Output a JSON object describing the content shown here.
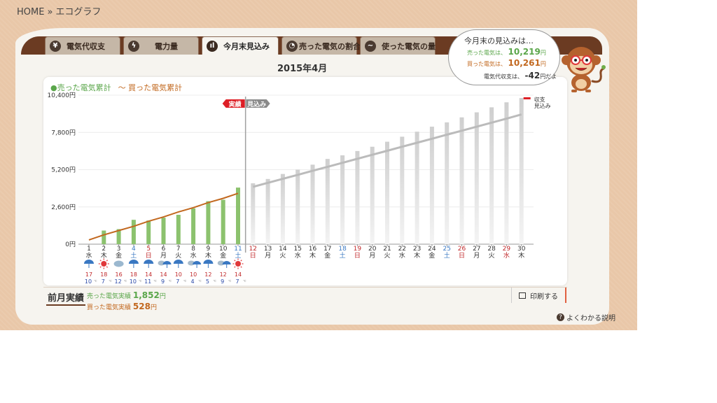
{
  "breadcrumb": {
    "home": "HOME",
    "separator": "»",
    "current": "エコグラフ"
  },
  "tabs": [
    {
      "label": "電気代収支",
      "icon": "yen-icon",
      "glyph": "¥"
    },
    {
      "label": "電力量",
      "icon": "lightning-icon",
      "glyph": "ϟ"
    },
    {
      "label": "今月末見込み",
      "icon": "bar-chart-icon",
      "glyph": "ıl"
    },
    {
      "label": "売った電気の割合",
      "icon": "pie-chart-icon",
      "glyph": "◔"
    },
    {
      "label": "使った電気の量",
      "icon": "wave-icon",
      "glyph": "∼"
    }
  ],
  "active_tab": 2,
  "month_title": "2015年4月",
  "legend": {
    "sold": "●売った電気累計",
    "bought": "〜 買った電気累計"
  },
  "markers": {
    "actual": "実績",
    "forecast": "見込み",
    "end_label": [
      "収支",
      "見込み"
    ]
  },
  "chart_data": {
    "type": "bar",
    "y_ticks": [
      "0円",
      "2,600円",
      "5,200円",
      "7,800円",
      "10,400円"
    ],
    "ylim": [
      0,
      10400
    ],
    "days": [
      1,
      2,
      3,
      4,
      5,
      6,
      7,
      8,
      9,
      10,
      11,
      12,
      13,
      14,
      15,
      16,
      17,
      18,
      19,
      20,
      21,
      22,
      23,
      24,
      25,
      26,
      27,
      28,
      29,
      30
    ],
    "weekdays": [
      "水",
      "木",
      "金",
      "土",
      "日",
      "月",
      "火",
      "水",
      "木",
      "金",
      "土",
      "日",
      "月",
      "火",
      "水",
      "木",
      "金",
      "土",
      "日",
      "月",
      "火",
      "水",
      "木",
      "金",
      "土",
      "日",
      "月",
      "火",
      "水",
      "木"
    ],
    "day_colors": [
      "#333",
      "#333",
      "#333",
      "#3a78c2",
      "#c0282a",
      "#333",
      "#333",
      "#333",
      "#333",
      "#333",
      "#3a78c2",
      "#c0282a",
      "#333",
      "#333",
      "#333",
      "#333",
      "#333",
      "#3a78c2",
      "#c0282a",
      "#333",
      "#333",
      "#333",
      "#333",
      "#333",
      "#3a78c2",
      "#c0282a",
      "#333",
      "#333",
      "#c0282a",
      "#333"
    ],
    "actual_days": 11,
    "sold_cumulative": [
      0,
      950,
      1050,
      1700,
      1650,
      1850,
      2050,
      2500,
      3000,
      3100,
      3950,
      4250,
      4550,
      4900,
      5200,
      5550,
      5950,
      6200,
      6500,
      6800,
      7150,
      7500,
      7850,
      8200,
      8500,
      8850,
      9200,
      9550,
      9900,
      10200
    ],
    "bought_cumulative": [
      300,
      650,
      950,
      1250,
      1600,
      1900,
      2250,
      2550,
      2900,
      3200,
      3550,
      4000,
      4280,
      4560,
      4840,
      5120,
      5400,
      5680,
      5960,
      6240,
      6520,
      6800,
      7080,
      7360,
      7640,
      7920,
      8200,
      8480,
      8760,
      9050
    ],
    "weather": [
      {
        "icon": "rain-icon",
        "high": "17",
        "low": "10"
      },
      {
        "icon": "sun-icon",
        "high": "18",
        "low": "7"
      },
      {
        "icon": "cloud-icon",
        "high": "16",
        "low": "12"
      },
      {
        "icon": "rain-icon",
        "high": "18",
        "low": "10"
      },
      {
        "icon": "rain-icon",
        "high": "14",
        "low": "11"
      },
      {
        "icon": "cloud-rain-icon",
        "high": "14",
        "low": "9"
      },
      {
        "icon": "rain-icon",
        "high": "10",
        "low": "7"
      },
      {
        "icon": "cloud-rain-icon",
        "high": "10",
        "low": "4"
      },
      {
        "icon": "rain-icon",
        "high": "12",
        "low": "5"
      },
      {
        "icon": "cloud-rain-icon",
        "high": "12",
        "low": "9"
      },
      {
        "icon": "sun-icon",
        "high": "14",
        "low": "7"
      }
    ],
    "temp_unit": "℃",
    "colors": {
      "sold": "#8cc26e",
      "forecast": "#d3d3d3",
      "bought": "#c2681f",
      "high": "#c0282a",
      "low": "#2a48a8"
    }
  },
  "forecast": {
    "title": "今月末の見込みは…",
    "sold_label": "売った電気は、",
    "sold_value": "10,219",
    "sold_unit": "円",
    "bought_label": "買った電気は、",
    "bought_value": "10,261",
    "bought_unit": "円",
    "balance_label": "電気代収支は、",
    "balance_value": "-42",
    "balance_unit": "円だよ"
  },
  "previous_month": {
    "title": "前月実績",
    "sold_label": "売った電気実績",
    "sold_value": "1,852",
    "sold_unit": "円",
    "bought_label": "買った電気実績",
    "bought_value": "528",
    "bought_unit": "円"
  },
  "print_label": "印刷する",
  "help_label": "よくわかる説明"
}
